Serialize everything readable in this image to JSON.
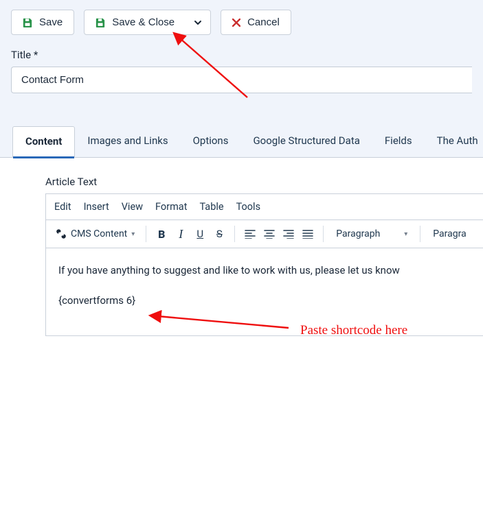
{
  "toolbar": {
    "save_label": "Save",
    "save_close_label": "Save & Close",
    "cancel_label": "Cancel"
  },
  "title_field": {
    "label": "Title *",
    "value": "Contact Form"
  },
  "tabs": [
    {
      "label": "Content"
    },
    {
      "label": "Images and Links"
    },
    {
      "label": "Options"
    },
    {
      "label": "Google Structured Data"
    },
    {
      "label": "Fields"
    },
    {
      "label": "The Auth"
    }
  ],
  "editor": {
    "section_label": "Article Text",
    "menus": [
      "Edit",
      "Insert",
      "View",
      "Format",
      "Table",
      "Tools"
    ],
    "cms_label": "CMS Content",
    "format_dropdown1": "Paragraph",
    "format_dropdown2": "Paragra",
    "content_line1": "If you have anything to suggest and like to work with us, please let us know",
    "content_line2": "{convertforms 6}"
  },
  "annotation": {
    "text": "Paste shortcode here"
  }
}
